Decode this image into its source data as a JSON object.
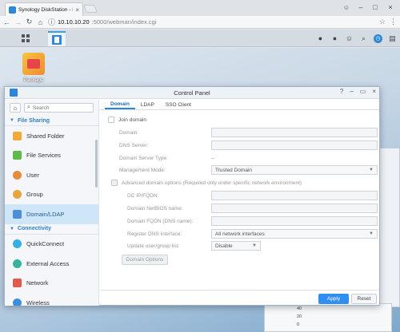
{
  "browser": {
    "tab_title": "Synology DiskStation - DS",
    "url_host": "10.10.10.20",
    "url_path": ":5000/webman/index.cgi"
  },
  "desktop": {
    "package_label": "Package",
    "widget_values": [
      "40",
      "20",
      "0"
    ]
  },
  "window": {
    "title": "Control Panel"
  },
  "sidebar": {
    "search_placeholder": "Search",
    "sections": [
      {
        "label": "File Sharing"
      },
      {
        "label": "Connectivity"
      }
    ],
    "items": [
      {
        "label": "Shared Folder",
        "color": "#f2a93b"
      },
      {
        "label": "File Services",
        "color": "#5dbb4a"
      },
      {
        "label": "User",
        "color": "#e28d3c"
      },
      {
        "label": "Group",
        "color": "#e7a53e"
      },
      {
        "label": "Domain/LDAP",
        "color": "#4c8fd6"
      },
      {
        "label": "QuickConnect",
        "color": "#35b0e0"
      },
      {
        "label": "External Access",
        "color": "#3bb39b"
      },
      {
        "label": "Network",
        "color": "#e05a4e"
      },
      {
        "label": "Wireless",
        "color": "#3b8fe0"
      }
    ]
  },
  "tabs": [
    "Domain",
    "LDAP",
    "SSO Client"
  ],
  "form": {
    "join_domain": "Join domain",
    "domain": "Domain:",
    "dns_server": "DNS Server:",
    "server_type": "Domain Server Type:",
    "server_type_value": "--",
    "management_mode": "Management Mode:",
    "management_mode_value": "Trusted Domain",
    "advanced": "Advanced domain options (Required only under specific network environment)",
    "dc_ip": "DC IP/FQDN:",
    "netbios": "Domain NetBIOS name:",
    "fqdn": "Domain FQDN (DNS name):",
    "register_dns": "Register DNS interface:",
    "register_dns_value": "All network interfaces",
    "update_list": "Update user/group list:",
    "update_list_value": "Disable",
    "domain_options": "Domain Options"
  },
  "footer": {
    "apply": "Apply",
    "reset": "Reset"
  }
}
